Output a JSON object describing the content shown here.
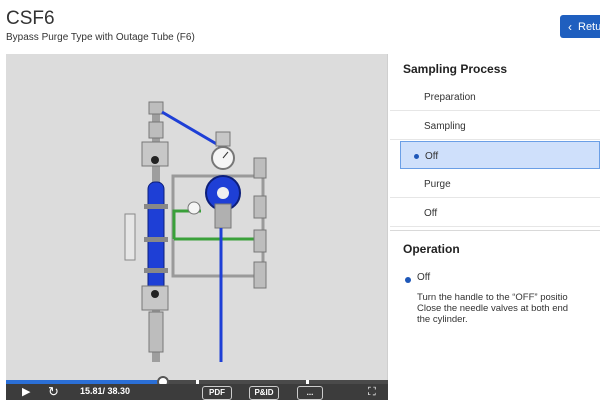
{
  "header": {
    "title": "CSF6",
    "subtitle": "Bypass Purge Type with Outage Tube (F6)",
    "return_label": "Retu"
  },
  "player": {
    "time_readout": "15.81/ 38.30",
    "progress_fraction": 0.41,
    "pdf_label": "PDF",
    "pid_label": "P&ID",
    "caption_label": "...",
    "colors": {
      "progress": "#2b6fd6",
      "accent": "#1f5fbf"
    }
  },
  "panel": {
    "sampling_title": "Sampling Process",
    "steps": [
      {
        "label": "Preparation",
        "active": false
      },
      {
        "label": "Sampling",
        "active": false
      },
      {
        "label": "Off",
        "active": true
      },
      {
        "label": "Purge",
        "active": false
      },
      {
        "label": "Off",
        "active": false
      }
    ],
    "operation_title": "Operation",
    "operation_state": "Off",
    "operation_text": "Turn the handle to the “OFF” positio\nClose the needle valves at both end\nthe cylinder."
  }
}
